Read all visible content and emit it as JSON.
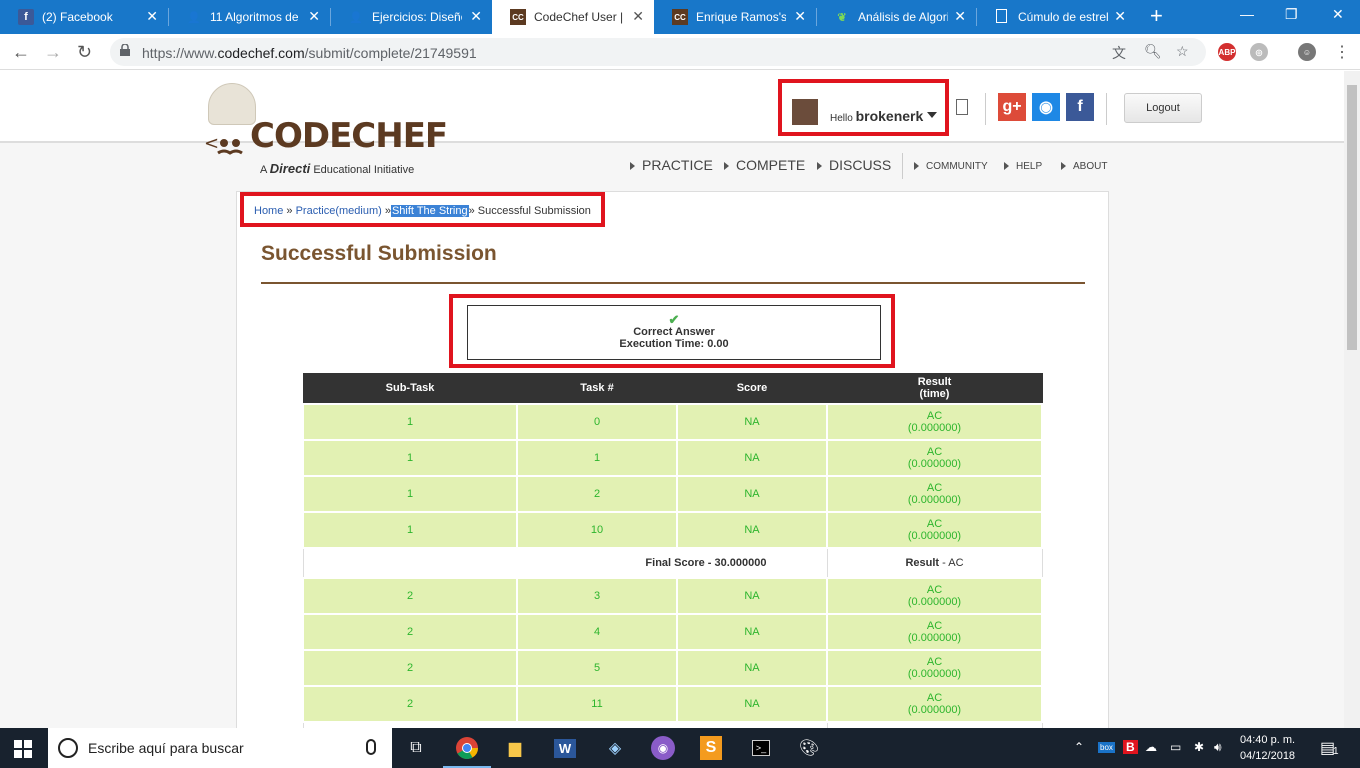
{
  "browser": {
    "tabs": [
      {
        "title": "(2) Facebook",
        "favicon": "f",
        "color": "#3b5998"
      },
      {
        "title": "11 Algoritmos de",
        "favicon": "👤",
        "color": "#8ab"
      },
      {
        "title": "Ejercicios: Diseño",
        "favicon": "👤",
        "color": "#8ab"
      },
      {
        "title": "CodeChef User | C",
        "favicon": "CC",
        "color": "#5c3a21"
      },
      {
        "title": "Enrique Ramos's s",
        "favicon": "CC",
        "color": "#5c3a21"
      },
      {
        "title": "Análisis de Algorit",
        "favicon": "◉",
        "color": "#2db52d"
      },
      {
        "title": "Cúmulo de estrell",
        "favicon": "▯",
        "color": "#ddd"
      }
    ],
    "url_prefix": "https://www.",
    "url_domain": "codechef.com",
    "url_path": "/submit/complete/21749591",
    "extensions": [
      "ABP"
    ]
  },
  "site": {
    "logo_text": "CODECHEF",
    "logo_sub_a": "A",
    "logo_sub_brand": "Directi",
    "logo_sub_rest": "Educational Initiative",
    "hello": "Hello",
    "username": "brokenerk",
    "logout": "Logout",
    "nav_main": [
      "PRACTICE",
      "COMPETE",
      "DISCUSS"
    ],
    "nav_sub": [
      "COMMUNITY",
      "HELP",
      "ABOUT"
    ],
    "social": [
      {
        "label": "g+",
        "color": "#dd4b39"
      },
      {
        "label": "◉",
        "color": "#1e88e5"
      },
      {
        "label": "f",
        "color": "#3b5998"
      }
    ]
  },
  "breadcrumb": {
    "home": "Home",
    "practice": "Practice(medium)",
    "problem": "Shift The String",
    "current": "Successful Submission",
    "sep": "»"
  },
  "page_title": "Successful Submission",
  "result": {
    "check": "✔",
    "status": "Correct Answer",
    "exec_time": "Execution Time: 0.00"
  },
  "table": {
    "headers": [
      "Sub-Task",
      "Task #",
      "Score",
      "Result",
      "(time)"
    ],
    "group1": [
      {
        "subtask": "1",
        "task": "0",
        "score": "NA",
        "result": "AC",
        "time": "(0.000000)"
      },
      {
        "subtask": "1",
        "task": "1",
        "score": "NA",
        "result": "AC",
        "time": "(0.000000)"
      },
      {
        "subtask": "1",
        "task": "2",
        "score": "NA",
        "result": "AC",
        "time": "(0.000000)"
      },
      {
        "subtask": "1",
        "task": "10",
        "score": "NA",
        "result": "AC",
        "time": "(0.000000)"
      }
    ],
    "final": {
      "score": "Final Score - 30.000000",
      "result_label": "Result",
      "result_value": " - AC"
    },
    "group2": [
      {
        "subtask": "2",
        "task": "3",
        "score": "NA",
        "result": "AC",
        "time": "(0.000000)"
      },
      {
        "subtask": "2",
        "task": "4",
        "score": "NA",
        "result": "AC",
        "time": "(0.000000)"
      },
      {
        "subtask": "2",
        "task": "5",
        "score": "NA",
        "result": "AC",
        "time": "(0.000000)"
      },
      {
        "subtask": "2",
        "task": "11",
        "score": "NA",
        "result": "AC",
        "time": "(0.000000)"
      }
    ]
  },
  "taskbar": {
    "search_placeholder": "Escribe aquí para buscar",
    "time": "04:40 p. m.",
    "date": "04/12/2018",
    "notification_count": "1"
  }
}
